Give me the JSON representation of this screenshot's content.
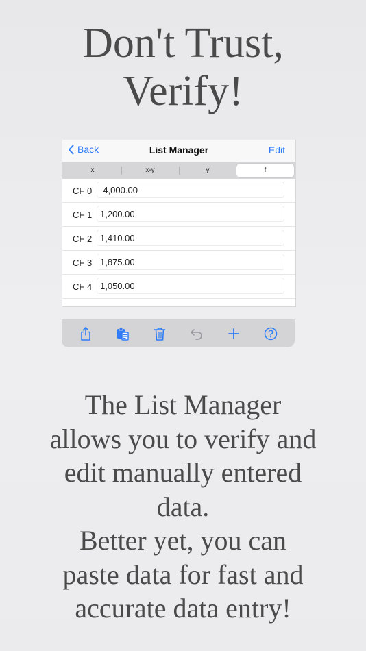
{
  "headline": {
    "line1": "Don't Trust,",
    "line2": "Verify!"
  },
  "navbar": {
    "back_label": "Back",
    "title": "List Manager",
    "edit_label": "Edit"
  },
  "segments": [
    {
      "label": "x",
      "selected": false
    },
    {
      "label": "x-y",
      "selected": false
    },
    {
      "label": "y",
      "selected": false
    },
    {
      "label": "f",
      "selected": true
    }
  ],
  "rows": [
    {
      "label": "CF 0",
      "value": "-4,000.00"
    },
    {
      "label": "CF 1",
      "value": "1,200.00"
    },
    {
      "label": "CF 2",
      "value": "1,410.00"
    },
    {
      "label": "CF 3",
      "value": "1,875.00"
    },
    {
      "label": "CF 4",
      "value": "1,050.00"
    }
  ],
  "toolbar": {
    "icons": [
      "share-icon",
      "paste-icon",
      "trash-icon",
      "undo-icon",
      "plus-icon",
      "help-icon"
    ],
    "accent": "#2f7cf6",
    "disabled": "#9a9aa0"
  },
  "description": {
    "line1": "The List Manager",
    "line2": "allows you to verify and",
    "line3": "edit manually entered",
    "line4": "data.",
    "line5": "Better yet, you can",
    "line6": "paste data for fast and",
    "line7": "accurate data entry!"
  }
}
